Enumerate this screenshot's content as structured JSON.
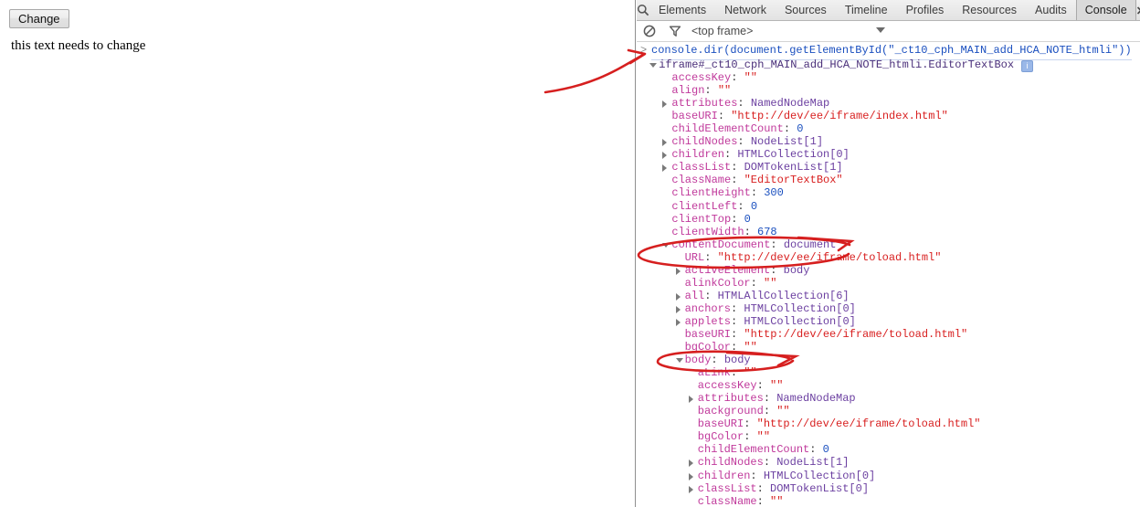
{
  "page": {
    "change_button": "Change",
    "body_text": "this text needs to change"
  },
  "devtools": {
    "search_icon": "search-icon",
    "tabs": [
      {
        "label": "Elements",
        "active": false
      },
      {
        "label": "Network",
        "active": false
      },
      {
        "label": "Sources",
        "active": false
      },
      {
        "label": "Timeline",
        "active": false
      },
      {
        "label": "Profiles",
        "active": false
      },
      {
        "label": "Resources",
        "active": false
      },
      {
        "label": "Audits",
        "active": false
      },
      {
        "label": "Console",
        "active": true
      }
    ],
    "right_icons": [
      "console-drawer-icon",
      "settings-gear-icon",
      "dock-position-icon"
    ],
    "filterbar": {
      "clear_icon": "clear-console-icon",
      "filter_icon": "filter-funnel-icon",
      "frame_selector": "<top frame>",
      "caret_icon": "chevron-down-icon"
    }
  },
  "console": {
    "prompt_symbol": ">",
    "command": "console.dir(document.getElementById(\"_ct10_cph_MAIN_add_HCA_NOTE_htmli\"))",
    "info_badge": "i",
    "lines": [
      {
        "indent": 1,
        "tri": "open",
        "key": "iframe#_ct10_cph_MAIN_add_HCA_NOTE_htmli.EditorTextBox",
        "keyclass": "hdr",
        "sep": "",
        "val": "",
        "valclass": "",
        "badge": true
      },
      {
        "indent": 2,
        "tri": "",
        "key": "accessKey",
        "keyclass": "k",
        "sep": ": ",
        "val": "\"\"",
        "valclass": "str"
      },
      {
        "indent": 2,
        "tri": "",
        "key": "align",
        "keyclass": "k",
        "sep": ": ",
        "val": "\"\"",
        "valclass": "str"
      },
      {
        "indent": 2,
        "tri": "closed",
        "key": "attributes",
        "keyclass": "k",
        "sep": ": ",
        "val": "NamedNodeMap",
        "valclass": "obj"
      },
      {
        "indent": 2,
        "tri": "",
        "key": "baseURI",
        "keyclass": "k",
        "sep": ": ",
        "val": "\"http://dev/ee/iframe/index.html\"",
        "valclass": "str"
      },
      {
        "indent": 2,
        "tri": "",
        "key": "childElementCount",
        "keyclass": "k",
        "sep": ": ",
        "val": "0",
        "valclass": "num"
      },
      {
        "indent": 2,
        "tri": "closed",
        "key": "childNodes",
        "keyclass": "k",
        "sep": ": ",
        "val": "NodeList[1]",
        "valclass": "obj"
      },
      {
        "indent": 2,
        "tri": "closed",
        "key": "children",
        "keyclass": "k",
        "sep": ": ",
        "val": "HTMLCollection[0]",
        "valclass": "obj"
      },
      {
        "indent": 2,
        "tri": "closed",
        "key": "classList",
        "keyclass": "k",
        "sep": ": ",
        "val": "DOMTokenList[1]",
        "valclass": "obj"
      },
      {
        "indent": 2,
        "tri": "",
        "key": "className",
        "keyclass": "k",
        "sep": ": ",
        "val": "\"EditorTextBox\"",
        "valclass": "str"
      },
      {
        "indent": 2,
        "tri": "",
        "key": "clientHeight",
        "keyclass": "k",
        "sep": ": ",
        "val": "300",
        "valclass": "num"
      },
      {
        "indent": 2,
        "tri": "",
        "key": "clientLeft",
        "keyclass": "k",
        "sep": ": ",
        "val": "0",
        "valclass": "num"
      },
      {
        "indent": 2,
        "tri": "",
        "key": "clientTop",
        "keyclass": "k",
        "sep": ": ",
        "val": "0",
        "valclass": "num"
      },
      {
        "indent": 2,
        "tri": "",
        "key": "clientWidth",
        "keyclass": "k",
        "sep": ": ",
        "val": "678",
        "valclass": "num"
      },
      {
        "indent": 2,
        "tri": "open",
        "key": "contentDocument",
        "keyclass": "k",
        "sep": ": ",
        "val": "document",
        "valclass": "obj"
      },
      {
        "indent": 3,
        "tri": "",
        "key": "URL",
        "keyclass": "k",
        "sep": ": ",
        "val": "\"http://dev/ee/iframe/toload.html\"",
        "valclass": "str"
      },
      {
        "indent": 3,
        "tri": "closed",
        "key": "activeElement",
        "keyclass": "k",
        "sep": ": ",
        "val": "body",
        "valclass": "obj"
      },
      {
        "indent": 3,
        "tri": "",
        "key": "alinkColor",
        "keyclass": "k",
        "sep": ": ",
        "val": "\"\"",
        "valclass": "str"
      },
      {
        "indent": 3,
        "tri": "closed",
        "key": "all",
        "keyclass": "k",
        "sep": ": ",
        "val": "HTMLAllCollection[6]",
        "valclass": "obj"
      },
      {
        "indent": 3,
        "tri": "closed",
        "key": "anchors",
        "keyclass": "k",
        "sep": ": ",
        "val": "HTMLCollection[0]",
        "valclass": "obj"
      },
      {
        "indent": 3,
        "tri": "closed",
        "key": "applets",
        "keyclass": "k",
        "sep": ": ",
        "val": "HTMLCollection[0]",
        "valclass": "obj"
      },
      {
        "indent": 3,
        "tri": "",
        "key": "baseURI",
        "keyclass": "k",
        "sep": ": ",
        "val": "\"http://dev/ee/iframe/toload.html\"",
        "valclass": "str"
      },
      {
        "indent": 3,
        "tri": "",
        "key": "bgColor",
        "keyclass": "k",
        "sep": ": ",
        "val": "\"\"",
        "valclass": "str"
      },
      {
        "indent": 3,
        "tri": "open",
        "key": "body",
        "keyclass": "k",
        "sep": ": ",
        "val": "body",
        "valclass": "obj"
      },
      {
        "indent": 4,
        "tri": "",
        "key": "aLink",
        "keyclass": "k",
        "sep": ": ",
        "val": "\"\"",
        "valclass": "str"
      },
      {
        "indent": 4,
        "tri": "",
        "key": "accessKey",
        "keyclass": "k",
        "sep": ": ",
        "val": "\"\"",
        "valclass": "str"
      },
      {
        "indent": 4,
        "tri": "closed",
        "key": "attributes",
        "keyclass": "k",
        "sep": ": ",
        "val": "NamedNodeMap",
        "valclass": "obj"
      },
      {
        "indent": 4,
        "tri": "",
        "key": "background",
        "keyclass": "k",
        "sep": ": ",
        "val": "\"\"",
        "valclass": "str"
      },
      {
        "indent": 4,
        "tri": "",
        "key": "baseURI",
        "keyclass": "k",
        "sep": ": ",
        "val": "\"http://dev/ee/iframe/toload.html\"",
        "valclass": "str"
      },
      {
        "indent": 4,
        "tri": "",
        "key": "bgColor",
        "keyclass": "k",
        "sep": ": ",
        "val": "\"\"",
        "valclass": "str"
      },
      {
        "indent": 4,
        "tri": "",
        "key": "childElementCount",
        "keyclass": "k",
        "sep": ": ",
        "val": "0",
        "valclass": "num"
      },
      {
        "indent": 4,
        "tri": "closed",
        "key": "childNodes",
        "keyclass": "k",
        "sep": ": ",
        "val": "NodeList[1]",
        "valclass": "obj"
      },
      {
        "indent": 4,
        "tri": "closed",
        "key": "children",
        "keyclass": "k",
        "sep": ": ",
        "val": "HTMLCollection[0]",
        "valclass": "obj"
      },
      {
        "indent": 4,
        "tri": "closed",
        "key": "classList",
        "keyclass": "k",
        "sep": ": ",
        "val": "DOMTokenList[0]",
        "valclass": "obj"
      },
      {
        "indent": 4,
        "tri": "",
        "key": "className",
        "keyclass": "k",
        "sep": ": ",
        "val": "\"\"",
        "valclass": "str"
      }
    ]
  },
  "annotations": {
    "color": "#d61f1f",
    "arrow_to_command": "red-curved-arrow",
    "ellipse_content_document": "red-ellipse",
    "ellipse_body": "red-ellipse"
  }
}
